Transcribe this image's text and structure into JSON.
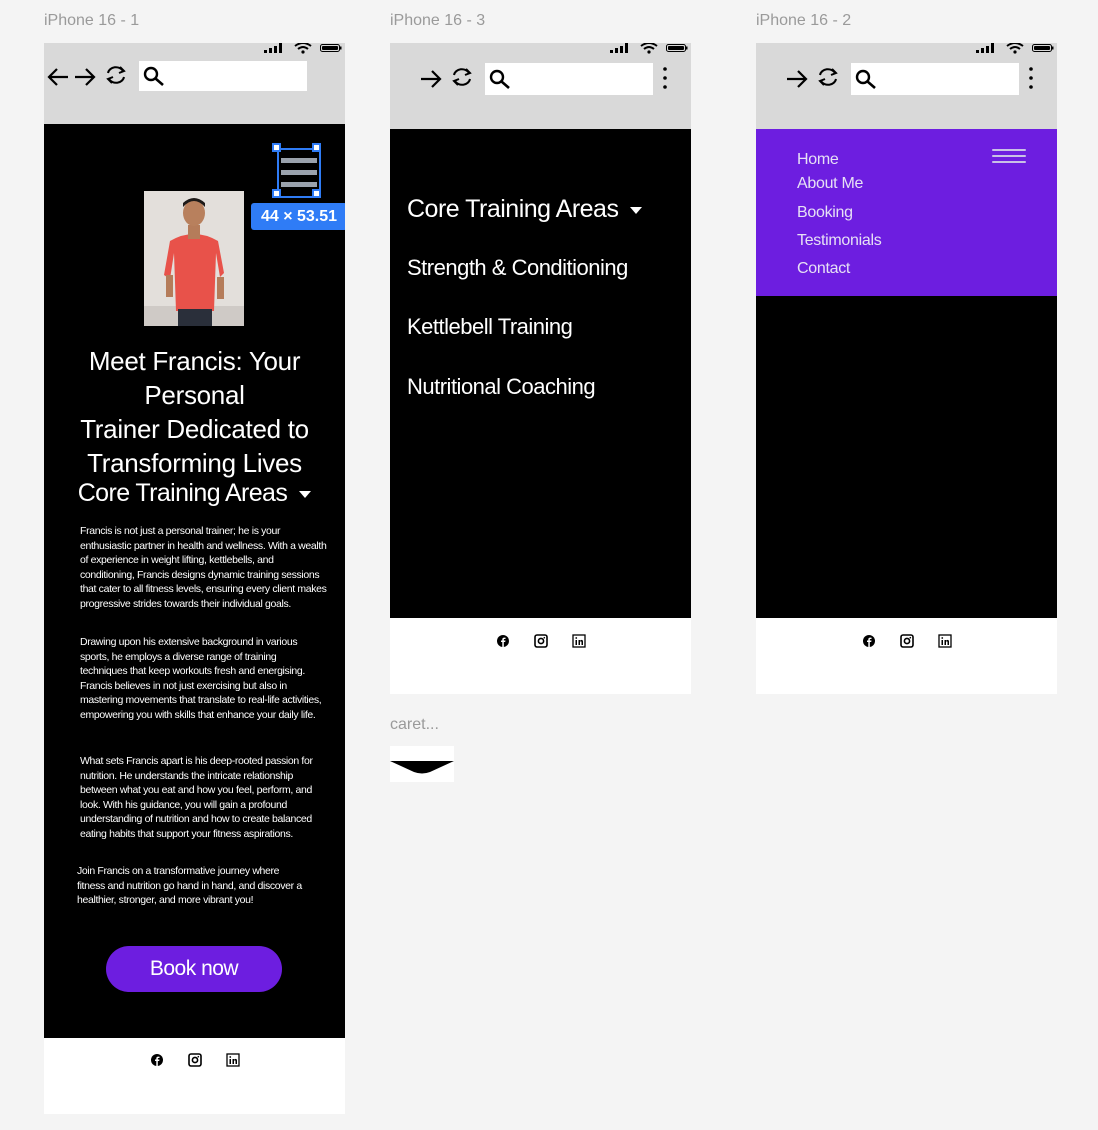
{
  "canvas": {
    "frames": [
      {
        "label": "iPhone 16 - 1"
      },
      {
        "label": "iPhone 16 - 3"
      },
      {
        "label": "iPhone 16 - 2"
      }
    ],
    "component_label": "caret...",
    "selection_size": "44 × 53.51"
  },
  "colors": {
    "accent": "#6d1ee0",
    "screen_bg": "#000000",
    "browser_bar": "#d9d9d9",
    "selection": "#2f7cf6",
    "canvas_bg": "#f4f4f4"
  },
  "browser": {
    "back_icon": "arrow-left-icon",
    "forward_icon": "arrow-right-icon",
    "refresh_icon": "refresh-icon",
    "search_icon": "search-icon",
    "menu_icon": "kebab-menu-icon",
    "search_value": ""
  },
  "home": {
    "title_lines": [
      "Meet Francis: Your Personal",
      "Trainer Dedicated to",
      "Transforming Lives"
    ],
    "core_heading": "Core Training Areas",
    "paragraphs": [
      "Francis is not just a personal trainer; he is your enthusiastic partner in health and wellness. With a wealth of experience in weight lifting, kettlebells, and conditioning, Francis designs dynamic training sessions that cater to all fitness levels, ensuring every client makes progressive strides towards their individual goals.",
      "Drawing upon his extensive background in various sports, he employs a diverse range of training techniques that keep workouts fresh and energising. Francis believes in not just exercising but also in mastering movements that translate to real-life activities, empowering you with skills that enhance your daily life.",
      "What sets Francis apart is his deep-rooted passion for nutrition. He understands the intricate relationship between what you eat and how you feel, perform, and look. With his guidance, you will gain a profound understanding of nutrition and how to create balanced eating habits that support your fitness aspirations.",
      "Join Francis on a transformative journey where fitness and nutrition go hand in hand, and discover a healthier, stronger, and more vibrant you!"
    ],
    "book_button": "Book now"
  },
  "dropdown": {
    "heading": "Core Training Areas",
    "items": [
      "Strength & Conditioning",
      "Kettlebell Training",
      "Nutritional Coaching"
    ]
  },
  "nav_menu": {
    "links": [
      "Home",
      "About Me",
      "Booking",
      "Testimonials",
      "Contact"
    ]
  },
  "footer": {
    "icons": [
      "facebook-icon",
      "instagram-icon",
      "linkedin-icon"
    ]
  }
}
